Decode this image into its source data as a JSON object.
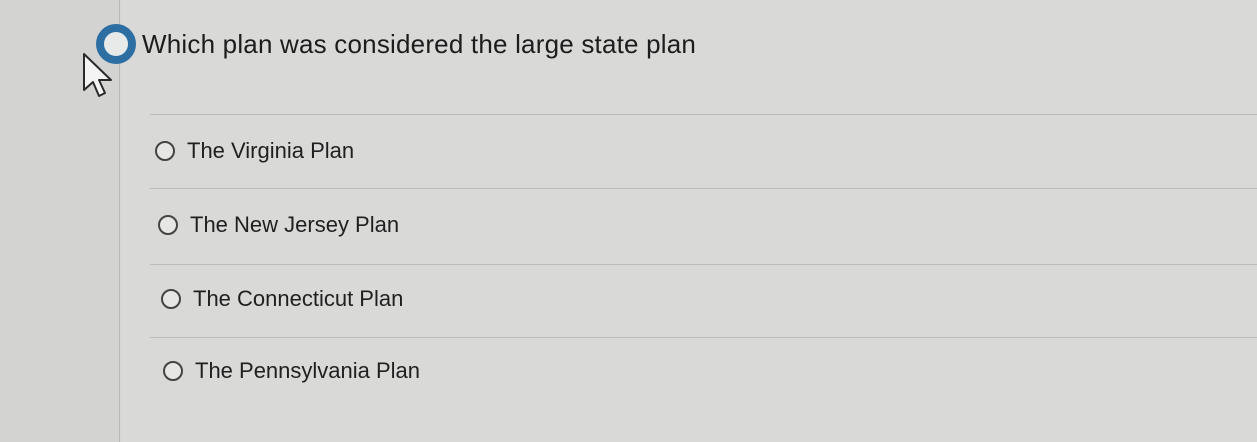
{
  "question": {
    "text": "Which plan was considered the large state plan"
  },
  "options": [
    {
      "label": "The Virginia Plan",
      "selected": false
    },
    {
      "label": "The New Jersey Plan",
      "selected": false
    },
    {
      "label": "The Connecticut Plan",
      "selected": false
    },
    {
      "label": "The Pennsylvania Plan",
      "selected": false
    }
  ],
  "colors": {
    "background": "#d6d7d5",
    "status_ring": "#2d6fa3",
    "text": "#1e1e1e"
  },
  "icons": {
    "status": "unanswered-ring-icon",
    "cursor": "mouse-pointer-icon"
  }
}
